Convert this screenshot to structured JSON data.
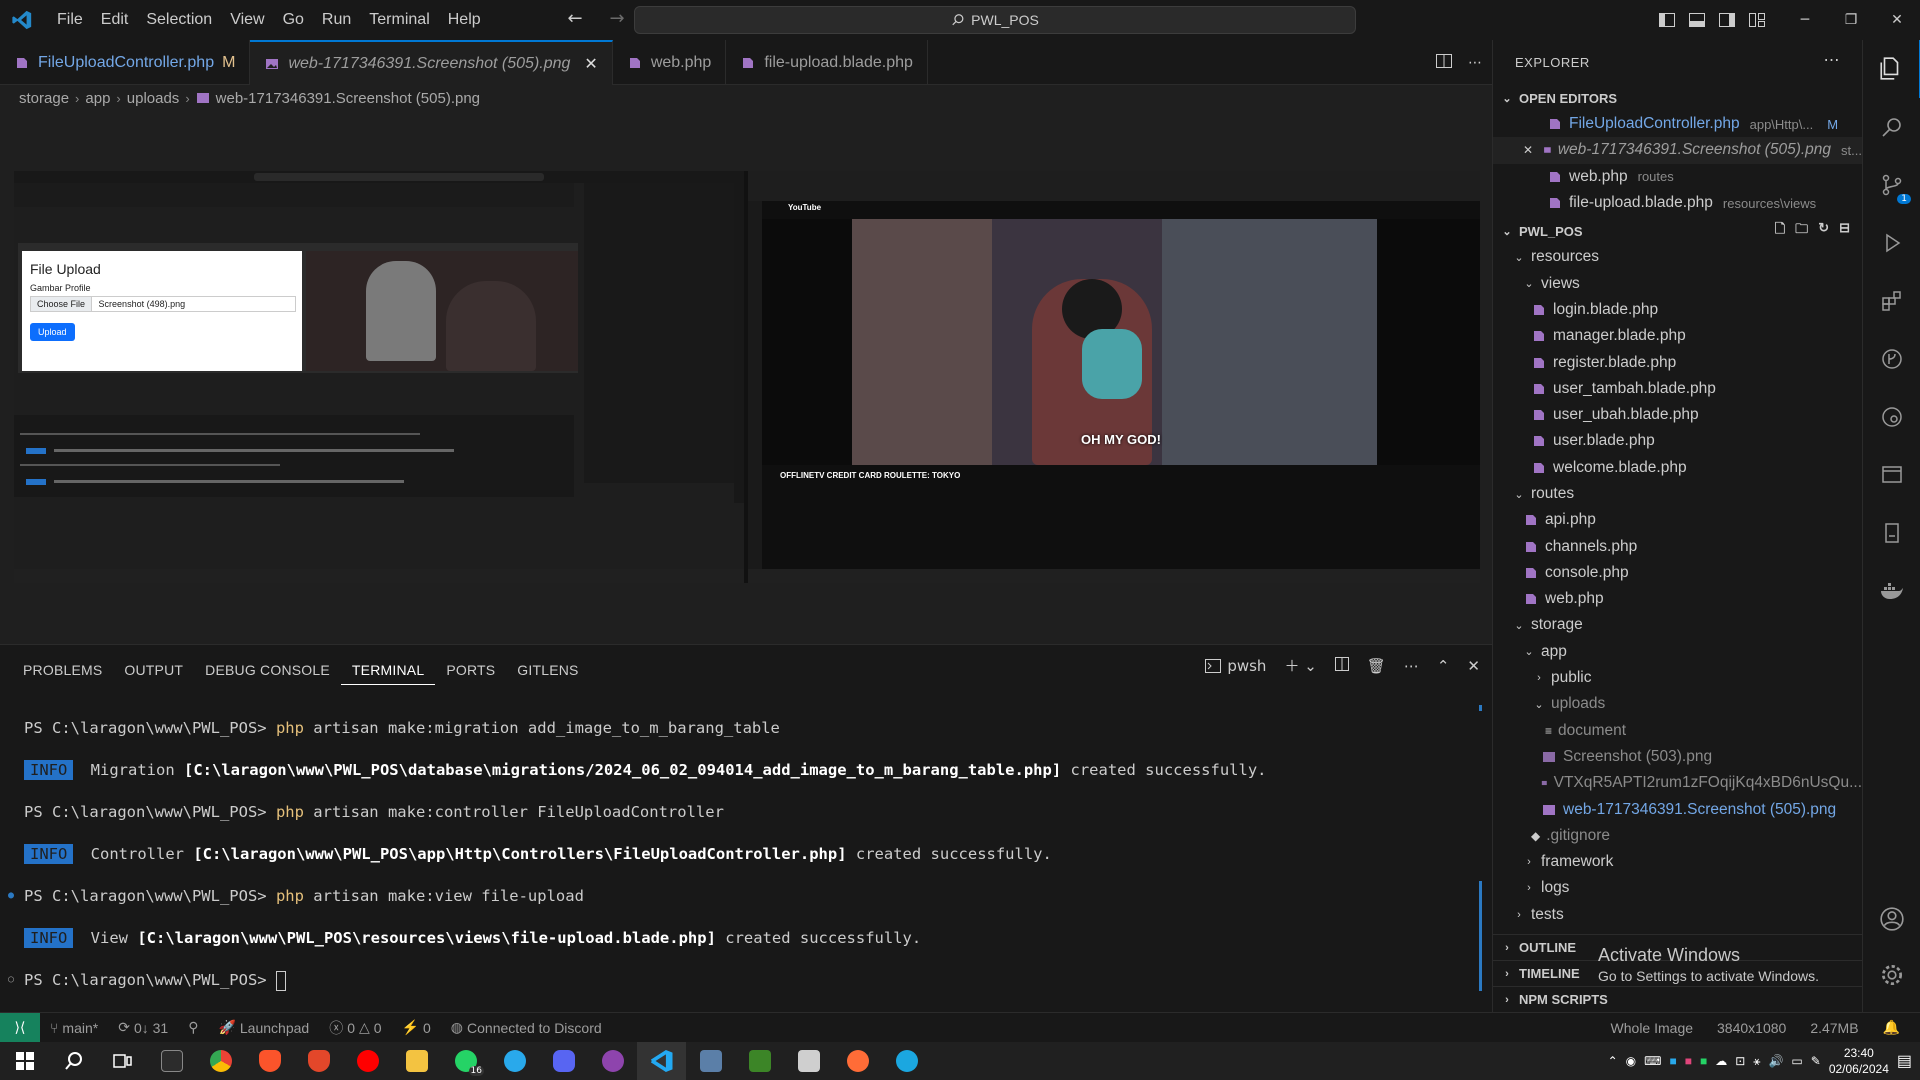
{
  "titlebar": {
    "menu": [
      "File",
      "Edit",
      "Selection",
      "View",
      "Go",
      "Run",
      "Terminal",
      "Help"
    ],
    "search_text": "PWL_POS"
  },
  "tabs": [
    {
      "label": "FileUploadController.php",
      "badge": "M"
    },
    {
      "label": "web-1717346391.Screenshot (505).png"
    },
    {
      "label": "web.php"
    },
    {
      "label": "file-upload.blade.php"
    }
  ],
  "breadcrumb": [
    "storage",
    "app",
    "uploads",
    "web-1717346391.Screenshot (505).png"
  ],
  "preview": {
    "inner_upload_title": "File Upload",
    "inner_upload_label": "Gambar Profile",
    "inner_choose_file": "Choose File",
    "inner_file_name": "Screenshot (498).png",
    "inner_upload_button": "Upload",
    "video_caption": "OH MY GOD!",
    "video_title": "OFFLINETV CREDIT CARD ROULETTE: TOKYO",
    "yt_logo": "YouTube"
  },
  "panel": {
    "tabs": [
      "PROBLEMS",
      "OUTPUT",
      "DEBUG CONSOLE",
      "TERMINAL",
      "PORTS",
      "GITLENS"
    ],
    "shell": "pwsh",
    "lines": [
      {
        "prompt": "PS C:\\laragon\\www\\PWL_POS> ",
        "cmd": "php",
        "args": " artisan make:migration add_image_to_m_barang_table"
      },
      {
        "badge": "INFO",
        "pre": " Migration ",
        "path": "[C:\\laragon\\www\\PWL_POS\\database\\migrations/2024_06_02_094014_add_image_to_m_barang_table.php]",
        "post": " created successfully."
      },
      {
        "prompt": "PS C:\\laragon\\www\\PWL_POS> ",
        "cmd": "php",
        "args": " artisan make:controller FileUploadController"
      },
      {
        "badge": "INFO",
        "pre": " Controller ",
        "path": "[C:\\laragon\\www\\PWL_POS\\app\\Http\\Controllers\\FileUploadController.php]",
        "post": " created successfully."
      },
      {
        "prompt": "PS C:\\laragon\\www\\PWL_POS> ",
        "cmd": "php",
        "args": " artisan make:view file-upload"
      },
      {
        "badge": "INFO",
        "pre": " View ",
        "path": "[C:\\laragon\\www\\PWL_POS\\resources\\views\\file-upload.blade.php]",
        "post": " created successfully."
      },
      {
        "prompt": "PS C:\\laragon\\www\\PWL_POS> ",
        "cmd": "",
        "args": ""
      }
    ]
  },
  "explorer": {
    "title": "EXPLORER",
    "open_editors_label": "OPEN EDITORS",
    "open_editors": [
      {
        "name": "FileUploadController.php",
        "desc": "app\\Http\\...",
        "badge": "M"
      },
      {
        "name": "web-1717346391.Screenshot (505).png",
        "desc": "st..."
      },
      {
        "name": "web.php",
        "desc": "routes"
      },
      {
        "name": "file-upload.blade.php",
        "desc": "resources\\views"
      }
    ],
    "project_label": "PWL_POS",
    "tree": {
      "resources": "resources",
      "views": "views",
      "view_files": [
        "login.blade.php",
        "manager.blade.php",
        "register.blade.php",
        "user_tambah.blade.php",
        "user_ubah.blade.php",
        "user.blade.php",
        "welcome.blade.php"
      ],
      "routes": "routes",
      "route_files": [
        "api.php",
        "channels.php",
        "console.php",
        "web.php"
      ],
      "storage": "storage",
      "app": "app",
      "public": "public",
      "uploads": "uploads",
      "upload_files": [
        "document",
        "Screenshot (503).png",
        "VTXqR5APTI2rum1zFOqijKq4xBD6nUsQu...",
        "web-1717346391.Screenshot (505).png"
      ],
      "gitignore": ".gitignore",
      "framework": "framework",
      "logs": "logs",
      "tests": "tests"
    },
    "bottom_sections": [
      "OUTLINE",
      "TIMELINE",
      "NPM SCRIPTS"
    ]
  },
  "activate": {
    "title": "Activate Windows",
    "sub": "Go to Settings to activate Windows."
  },
  "statusbar": {
    "branch": "main*",
    "sync": "0↓ 31",
    "launchpad": "Launchpad",
    "errors": "0",
    "warnings": "0",
    "ports": "0",
    "discord": "Connected to Discord",
    "right": [
      "Whole Image",
      "3840x1080",
      "2.47MB"
    ]
  },
  "taskbar": {
    "time": "23:40",
    "date": "02/06/2024",
    "whatsapp_badge": "16"
  },
  "colors": {
    "accent": "#0078d4",
    "remote": "#16825d",
    "info_badge": "#2472c8",
    "modified": "#73a7e6"
  }
}
